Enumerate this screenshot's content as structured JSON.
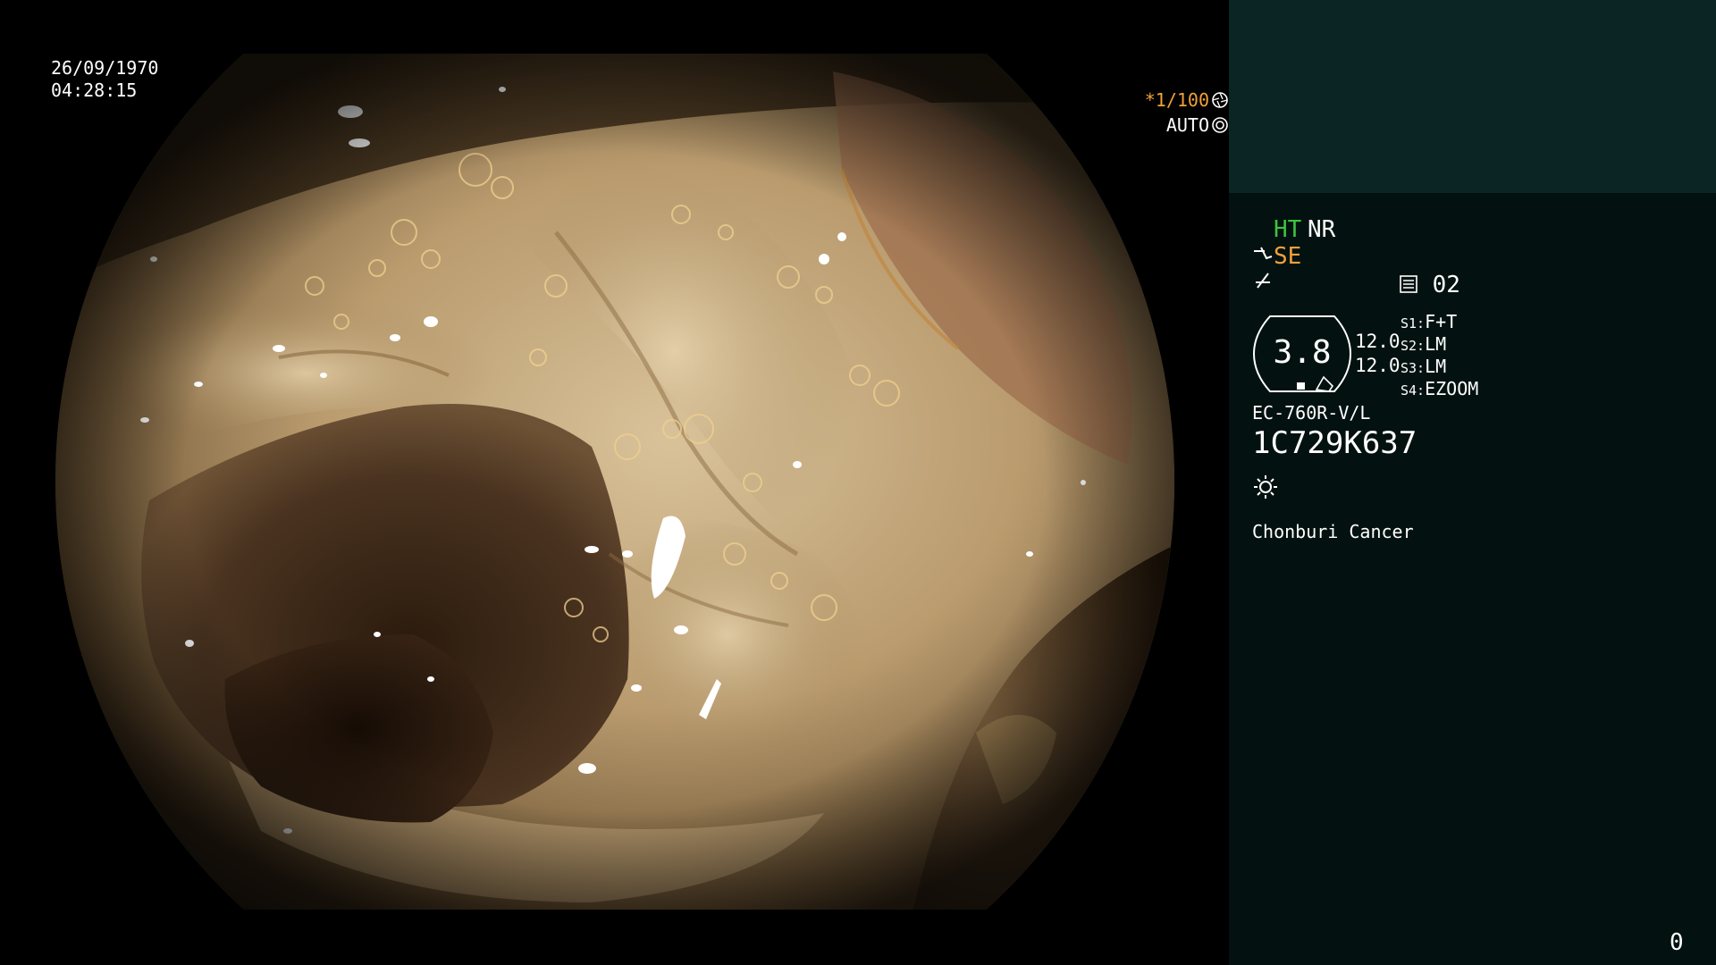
{
  "overlay": {
    "date": "26/09/1970",
    "time": "04:28:15",
    "shutter": "*1/100",
    "mode": "AUTO",
    "shutter_icon": "aperture-icon",
    "mode_icon": "iris-icon"
  },
  "panel": {
    "ht": "HT",
    "nr": "NR",
    "se": "SE",
    "memo_number": "02",
    "gauge_value": "3.8",
    "value_1": "12.0",
    "value_2": "12.0",
    "switches": [
      {
        "key": "S1:",
        "value": "F+T"
      },
      {
        "key": "S2:",
        "value": "LM"
      },
      {
        "key": "S3:",
        "value": "LM"
      },
      {
        "key": "S4:",
        "value": "EZOOM"
      }
    ],
    "scope_model": "EC-760R-V/L",
    "scope_serial": "1C729K637",
    "hospital": "Chonburi Cancer",
    "counter": "0"
  },
  "colors": {
    "ht_green": "#3ec43e",
    "se_orange": "#f0a23a",
    "panel_bg": "#031210",
    "panel_top_bg": "#0b2525"
  }
}
